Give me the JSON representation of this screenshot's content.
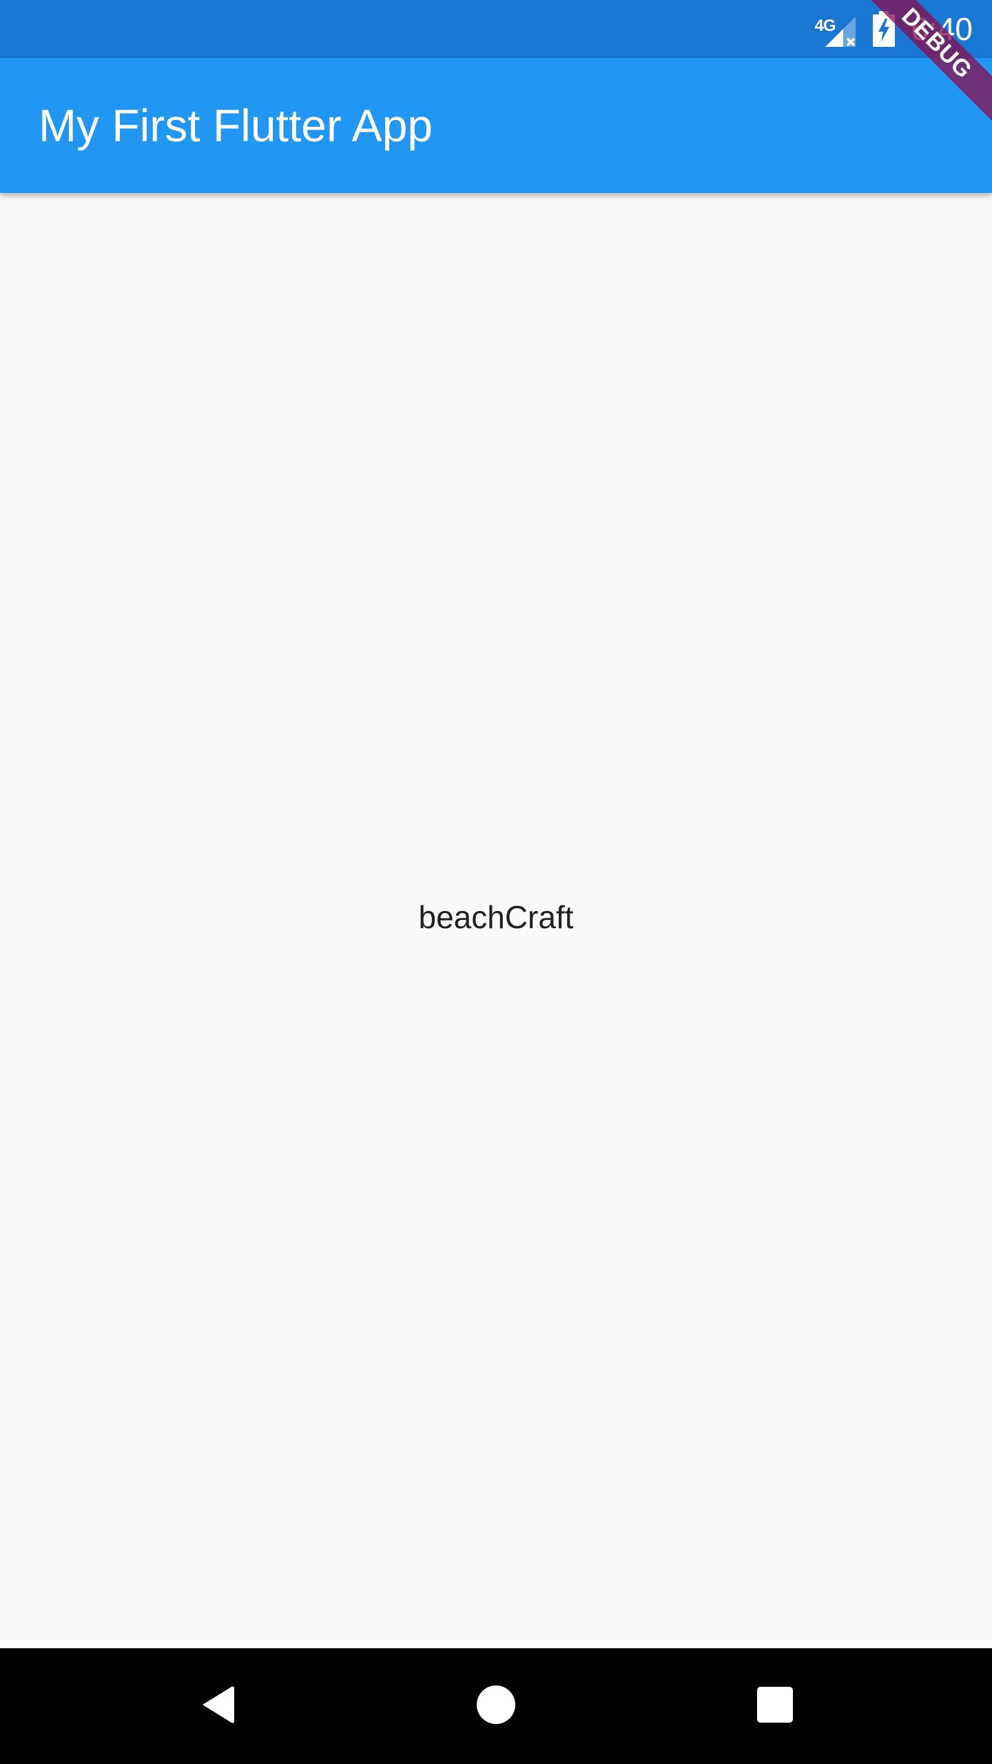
{
  "status_bar": {
    "network_label": "4G",
    "time": "6:40",
    "icons": [
      "signal-icon",
      "battery-charging-icon"
    ],
    "background_color": "#1976d2"
  },
  "app_bar": {
    "title": "My First Flutter App",
    "background_color": "#2196f3"
  },
  "debug_banner": {
    "label": "DEBUG"
  },
  "body": {
    "text": "beachCraft",
    "background_color": "#fafafa"
  },
  "nav_bar": {
    "icons": [
      "back-icon",
      "home-icon",
      "recents-icon"
    ],
    "background_color": "#000000"
  }
}
